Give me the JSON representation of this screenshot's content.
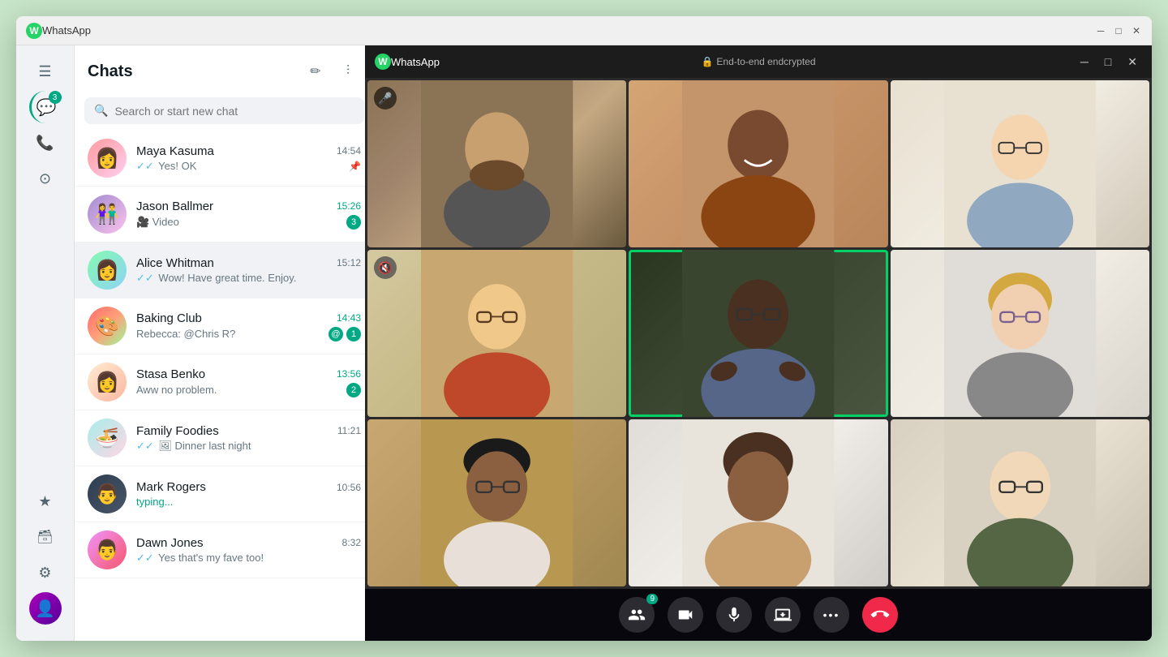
{
  "appWindow": {
    "title": "WhatsApp",
    "titleBarBg": "#f0f0f0"
  },
  "sidebar": {
    "icons": [
      {
        "id": "menu",
        "symbol": "☰",
        "active": false,
        "badge": null
      },
      {
        "id": "chats",
        "symbol": "💬",
        "active": true,
        "badge": "3"
      },
      {
        "id": "calls",
        "symbol": "📞",
        "active": false,
        "badge": null
      },
      {
        "id": "status",
        "symbol": "⊙",
        "active": false,
        "badge": null
      }
    ],
    "bottomIcons": [
      {
        "id": "starred",
        "symbol": "★",
        "active": false
      },
      {
        "id": "archived",
        "symbol": "🗄",
        "active": false
      },
      {
        "id": "settings",
        "symbol": "⚙",
        "active": false
      }
    ]
  },
  "chatList": {
    "title": "Chats",
    "search": {
      "placeholder": "Search or start new chat"
    },
    "headerIcons": {
      "newChat": "✏",
      "filter": "⫶"
    },
    "chats": [
      {
        "id": "maya",
        "name": "Maya Kasuma",
        "time": "14:54",
        "preview": "Yes! OK",
        "unread": 0,
        "pinned": true,
        "tick": "double",
        "avatarClass": "av-maya",
        "avatarEmoji": "👩"
      },
      {
        "id": "jason",
        "name": "Jason Ballmer",
        "time": "15:26",
        "preview": "🎥 Video",
        "unread": 3,
        "timeUnread": true,
        "avatarClass": "av-jason",
        "avatarEmoji": "👫"
      },
      {
        "id": "alice",
        "name": "Alice Whitman",
        "time": "15:12",
        "preview": "Wow! Have great time. Enjoy.",
        "unread": 0,
        "active": true,
        "tick": "double",
        "avatarClass": "av-alice",
        "avatarEmoji": "👩"
      },
      {
        "id": "baking",
        "name": "Baking Club",
        "time": "14:43",
        "preview": "Rebecca: @Chris R?",
        "unread": 1,
        "mention": true,
        "timeUnread": true,
        "avatarClass": "av-baking",
        "avatarEmoji": "🎨"
      },
      {
        "id": "stasa",
        "name": "Stasa Benko",
        "time": "13:56",
        "preview": "Aww no problem.",
        "unread": 2,
        "timeUnread": true,
        "avatarClass": "av-stasa",
        "avatarEmoji": "👩"
      },
      {
        "id": "family",
        "name": "Family Foodies",
        "time": "11:21",
        "preview": "Dinner last night",
        "unread": 0,
        "tick": "double",
        "avatarClass": "av-family",
        "avatarEmoji": "🍜"
      },
      {
        "id": "mark",
        "name": "Mark Rogers",
        "time": "10:56",
        "preview": "typing...",
        "typing": true,
        "unread": 0,
        "avatarClass": "av-mark",
        "avatarEmoji": "👨"
      },
      {
        "id": "dawn",
        "name": "Dawn Jones",
        "time": "8:32",
        "preview": "Yes that's my fave too!",
        "unread": 0,
        "tick": "double",
        "avatarClass": "av-dawn",
        "avatarEmoji": "👨"
      }
    ]
  },
  "videoCall": {
    "appName": "WhatsApp",
    "e2eLabel": "End-to-end endcrypted",
    "participantCount": "9",
    "controls": {
      "participants": "👥",
      "camera": "📹",
      "mic": "🎤",
      "screenShare": "📤",
      "more": "•••",
      "endCall": "📞"
    },
    "participants": [
      {
        "id": 1,
        "muted": true
      },
      {
        "id": 2,
        "muted": false
      },
      {
        "id": 3,
        "muted": false
      },
      {
        "id": 4,
        "muted": true
      },
      {
        "id": 5,
        "highlighted": true,
        "muted": false
      },
      {
        "id": 6,
        "muted": false
      },
      {
        "id": 7,
        "muted": false
      },
      {
        "id": 8,
        "muted": false
      },
      {
        "id": 9,
        "muted": false
      }
    ]
  }
}
